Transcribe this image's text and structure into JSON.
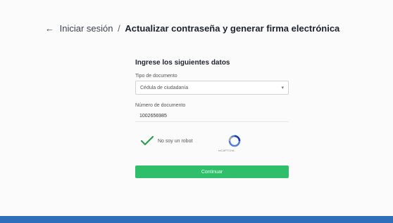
{
  "header": {
    "back_link": "Iniciar sesión",
    "separator": "/",
    "current_page": "Actualizar contraseña y generar firma electrónica"
  },
  "form": {
    "title": "Ingrese los siguientes datos",
    "document_type": {
      "label": "Tipo de documento",
      "value": "Cédula de ciudadanía"
    },
    "document_number": {
      "label": "Número de documento",
      "value": "1002656985"
    },
    "captcha": {
      "label": "No soy un robot",
      "checked": true,
      "brand": "reCAPTCHA"
    },
    "submit_label": "Continuar"
  },
  "colors": {
    "accent_green": "#2fbf6a",
    "bottom_bar_blue": "#2d6fb8",
    "check_green": "#2e9e4f"
  },
  "icons": {
    "back": "arrow-left-icon",
    "select": "chevron-down-icon",
    "captcha_check": "checkmark-icon",
    "captcha_logo": "recaptcha-icon"
  }
}
